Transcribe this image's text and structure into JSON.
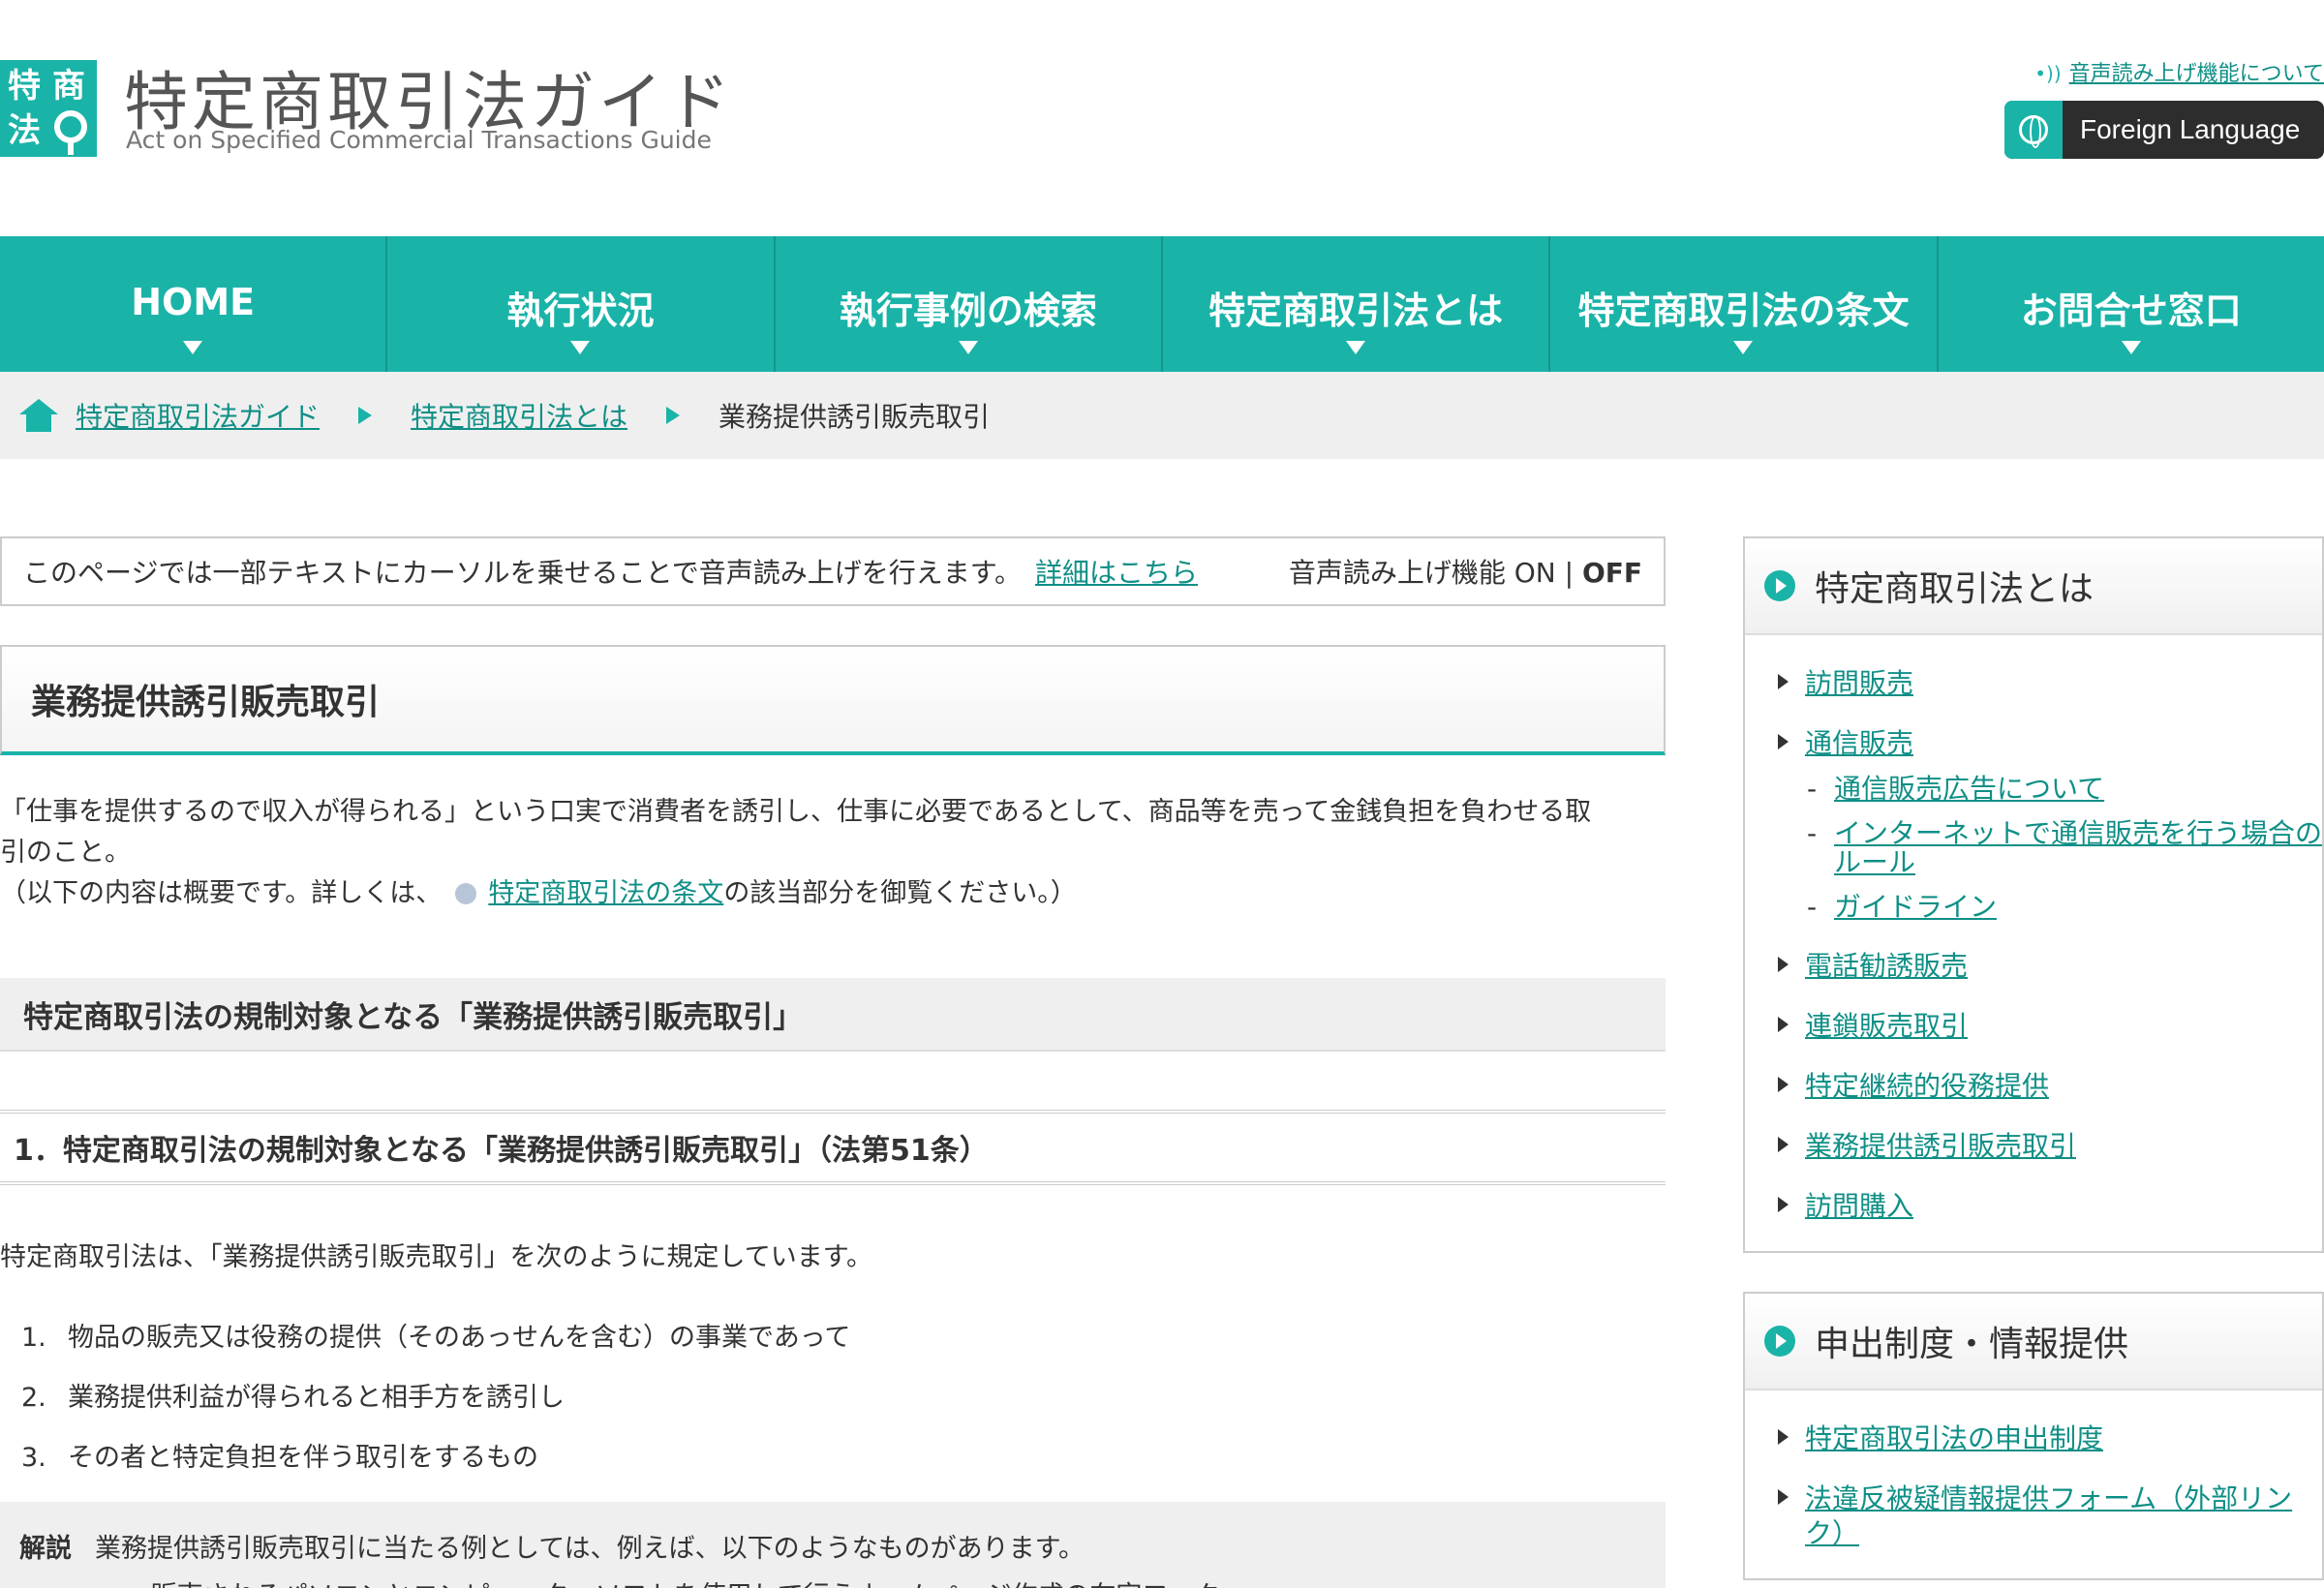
{
  "header": {
    "logo_chars": [
      "特",
      "商",
      "法"
    ],
    "title": "特定商取引法ガイド",
    "subtitle": "Act on Specified Commercial Transactions Guide",
    "voice_link": "音声読み上げ機能について",
    "foreign_button": "Foreign Language"
  },
  "nav": {
    "items": [
      "HOME",
      "執行状況",
      "執行事例の検索",
      "特定商取引法とは",
      "特定商取引法の条文",
      "お問合せ窓口"
    ]
  },
  "breadcrumb": {
    "items": [
      "特定商取引法ガイド",
      "特定商取引法とは"
    ],
    "current": "業務提供誘引販売取引"
  },
  "voice_bar": {
    "text": "このページでは一部テキストにカーソルを乗せることで音声読み上げを行えます。",
    "link": "詳細はこちら",
    "status_prefix": "音声読み上げ機能 ON | ",
    "status_off": "OFF"
  },
  "main": {
    "title": "業務提供誘引販売取引",
    "intro_line1": "「仕事を提供するので収入が得られる」という口実で消費者を誘引し、仕事に必要であるとして、商品等を売って金銭負担を負わせる取",
    "intro_line2": "引のこと。",
    "intro_line3_pre": "（以下の内容は概要です。詳しくは、",
    "intro_line3_link": "特定商取引法の条文",
    "intro_line3_post": "の該当部分を御覧ください。）",
    "h2": "特定商取引法の規制対象となる「業務提供誘引販売取引」",
    "h3": "1．特定商取引法の規制対象となる「業務提供誘引販売取引」（法第51条）",
    "lead": "特定商取引法は、「業務提供誘引販売取引」を次のように規定しています。",
    "list": [
      {
        "num": "1.",
        "text": "物品の販売又は役務の提供（そのあっせんを含む）の事業であって"
      },
      {
        "num": "2.",
        "text": "業務提供利益が得られると相手方を誘引し"
      },
      {
        "num": "3.",
        "text": "その者と特定負担を伴う取引をするもの"
      }
    ],
    "note_label": "解説",
    "note_text": "業務提供誘引販売取引に当たる例としては、例えば、以下のようなものがあります。",
    "note_sub": "・ 販売されるパソコンとコンピューターソフトを使用して行うホームページ作成の在宅ワーク"
  },
  "sidebar": {
    "box1": {
      "title": "特定商取引法とは",
      "items": [
        {
          "label": "訪問販売",
          "children": []
        },
        {
          "label": "通信販売",
          "children": [
            "通信販売広告について",
            "インターネットで通信販売を行う場合のルール",
            "ガイドライン"
          ]
        },
        {
          "label": "電話勧誘販売",
          "children": []
        },
        {
          "label": "連鎖販売取引",
          "children": []
        },
        {
          "label": "特定継続的役務提供",
          "children": []
        },
        {
          "label": "業務提供誘引販売取引",
          "children": []
        },
        {
          "label": "訪問購入",
          "children": []
        }
      ]
    },
    "box2": {
      "title": "申出制度・情報提供",
      "items": [
        "特定商取引法の申出制度",
        "法違反被疑情報提供フォーム（外部リンク）"
      ]
    }
  },
  "colors": {
    "accent": "#1ab3a8",
    "link": "#0f8f86",
    "nav_divider": "#15958c"
  },
  "icons": [
    "logo-mark",
    "sound-wave-icon",
    "globe-icon",
    "home-icon",
    "chevron-right-icon",
    "triangle-down-icon",
    "circle-play-icon",
    "bullet-triangle-icon",
    "doc-icon"
  ]
}
